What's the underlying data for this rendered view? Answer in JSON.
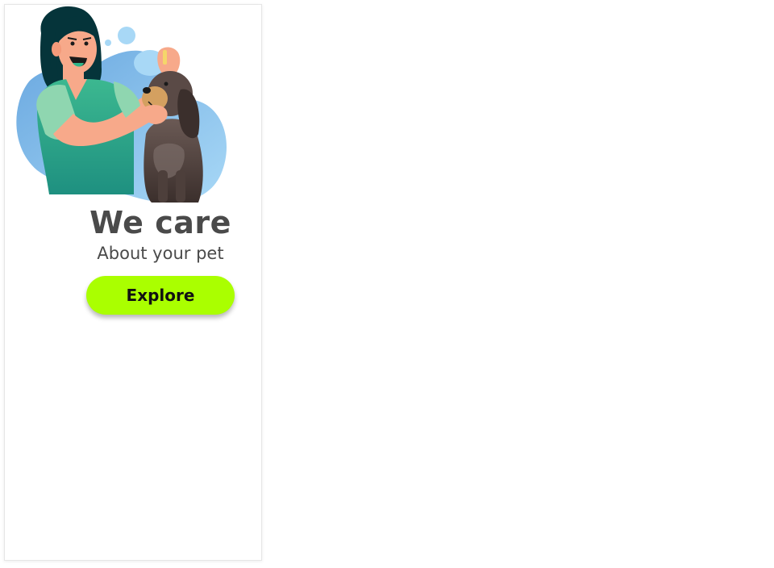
{
  "hero": {
    "title": "We care",
    "subtitle": "About your pet"
  },
  "actions": {
    "explore_label": "Explore"
  },
  "colors": {
    "accent": "#aaff00",
    "text": "#4a4a4a",
    "blob": "#8fc6ec"
  },
  "illustration": {
    "icon": "woman-with-dog-illustration"
  }
}
